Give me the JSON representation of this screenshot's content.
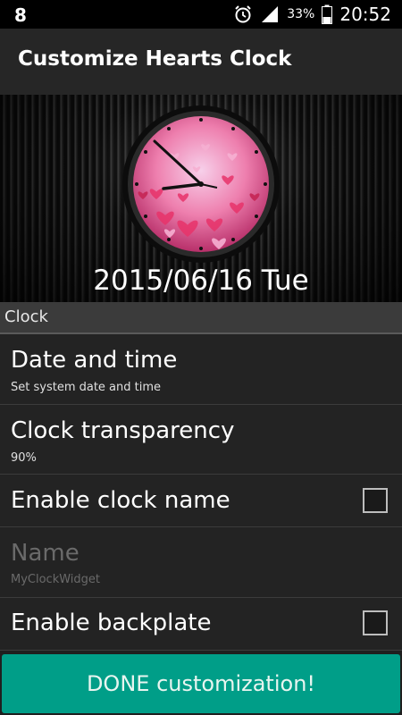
{
  "status_bar": {
    "left_icon": "app-notification-icon",
    "battery_percent": "33%",
    "time": "20:52",
    "icons": [
      "alarm-clock-icon",
      "signal-icon",
      "battery-icon"
    ]
  },
  "action_bar": {
    "title": "Customize Hearts Clock"
  },
  "preview": {
    "date": "2015/06/16 Tue",
    "clock_theme": "hearts",
    "clock_face_color": "#e05a8f"
  },
  "clock_category": {
    "label": "Clock"
  },
  "preferences": [
    {
      "title": "Date and time",
      "summary": "Set system date and time",
      "type": "link",
      "enabled": true
    },
    {
      "title": "Clock transparency",
      "summary": "90%",
      "type": "link",
      "enabled": true
    },
    {
      "title": "Enable clock name",
      "summary": "",
      "type": "checkbox",
      "checked": false,
      "enabled": true
    },
    {
      "title": "Name",
      "summary": "MyClockWidget",
      "type": "link",
      "enabled": false
    },
    {
      "title": "Enable backplate",
      "summary": "",
      "type": "checkbox",
      "checked": false,
      "enabled": true
    }
  ],
  "done_button": {
    "label": "DONE customization!",
    "color": "#009e88"
  }
}
